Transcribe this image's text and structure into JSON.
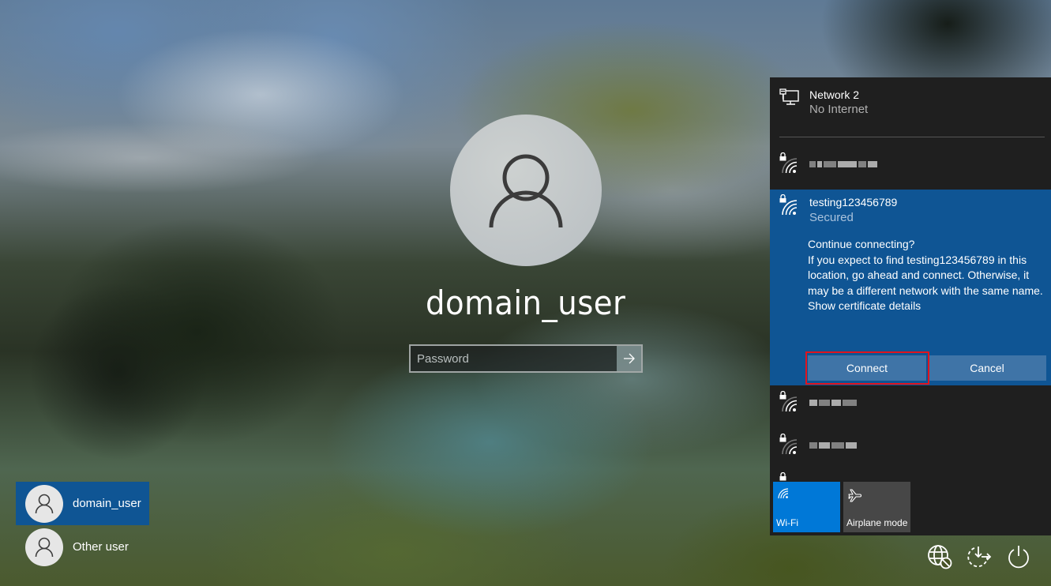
{
  "login": {
    "username": "domain_user",
    "password_placeholder": "Password",
    "password_value": "",
    "submit_icon": "arrow-right-icon"
  },
  "user_list": [
    {
      "name": "domain_user",
      "selected": true,
      "icon": "user-icon"
    },
    {
      "name": "Other user",
      "selected": false,
      "icon": "user-icon"
    }
  ],
  "network_flyout": {
    "wired": {
      "name": "Network 2",
      "status": "No Internet",
      "icon": "ethernet-monitor-icon"
    },
    "wifi_networks": [
      {
        "name": "[obscured]",
        "secured": true,
        "selected": false
      },
      {
        "name": "testing123456789",
        "status": "Secured",
        "secured": true,
        "selected": true,
        "prompt": {
          "title": "Continue connecting?",
          "body": "If you expect to find testing123456789 in this location, go ahead and connect. Otherwise, it may be a different network with the same name.",
          "link": "Show certificate details",
          "connect_label": "Connect",
          "cancel_label": "Cancel"
        }
      },
      {
        "name": "[obscured]",
        "secured": true,
        "selected": false
      },
      {
        "name": "[obscured]",
        "secured": true,
        "selected": false
      },
      {
        "name": "[obscured]",
        "secured": true,
        "selected": false
      }
    ],
    "quick_actions": [
      {
        "label": "Wi-Fi",
        "active": true,
        "icon": "wifi-icon"
      },
      {
        "label": "Airplane mode",
        "active": false,
        "icon": "airplane-icon"
      }
    ]
  },
  "system_icons": [
    {
      "name": "network-icon",
      "label": "Network"
    },
    {
      "name": "ease-of-access-icon",
      "label": "Ease of Access"
    },
    {
      "name": "power-icon",
      "label": "Power"
    }
  ],
  "colors": {
    "selection_blue": "#0f5594",
    "flyout_bg": "#1f1f1f",
    "wifi_tile_active": "#0078d7",
    "tile_inactive": "#474747",
    "button_bg": "#3f74a7",
    "highlight_red": "#e0141e"
  }
}
